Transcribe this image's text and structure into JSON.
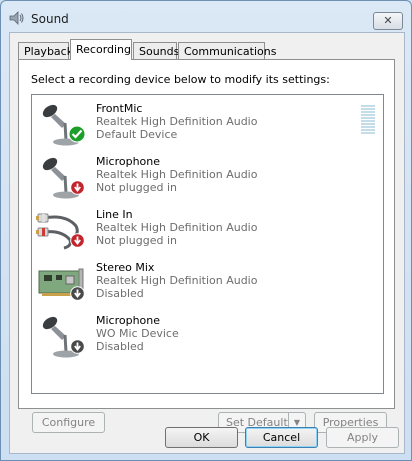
{
  "window": {
    "title": "Sound",
    "close_label": "✕"
  },
  "tabs": [
    {
      "label": "Playback",
      "active": false
    },
    {
      "label": "Recording",
      "active": true
    },
    {
      "label": "Sounds",
      "active": false
    },
    {
      "label": "Communications",
      "active": false
    }
  ],
  "panel": {
    "instruction": "Select a recording device below to modify its settings:"
  },
  "devices": [
    {
      "name": "FrontMic",
      "driver": "Realtek High Definition Audio",
      "status": "Default Device",
      "icon": "microphone-icon",
      "badge": "default-check-icon",
      "level_bars": 10
    },
    {
      "name": "Microphone",
      "driver": "Realtek High Definition Audio",
      "status": "Not plugged in",
      "icon": "microphone-icon",
      "badge": "unplugged-arrow-icon"
    },
    {
      "name": "Line In",
      "driver": "Realtek High Definition Audio",
      "status": "Not plugged in",
      "icon": "rca-cable-icon",
      "badge": "unplugged-arrow-icon"
    },
    {
      "name": "Stereo Mix",
      "driver": "Realtek High Definition Audio",
      "status": "Disabled",
      "icon": "sound-card-icon",
      "badge": "disabled-arrow-icon"
    },
    {
      "name": "Microphone",
      "driver": "WO Mic Device",
      "status": "Disabled",
      "icon": "microphone-icon",
      "badge": "disabled-arrow-icon"
    }
  ],
  "panel_buttons": {
    "configure": "Configure",
    "set_default": "Set Default",
    "properties": "Properties"
  },
  "dialog_buttons": {
    "ok": "OK",
    "cancel": "Cancel",
    "apply": "Apply"
  },
  "colors": {
    "default_badge": "#1b9e2a",
    "unplugged_badge": "#c0262c",
    "disabled_badge": "#4a4a4a",
    "level_meter": "#c5dde8"
  }
}
